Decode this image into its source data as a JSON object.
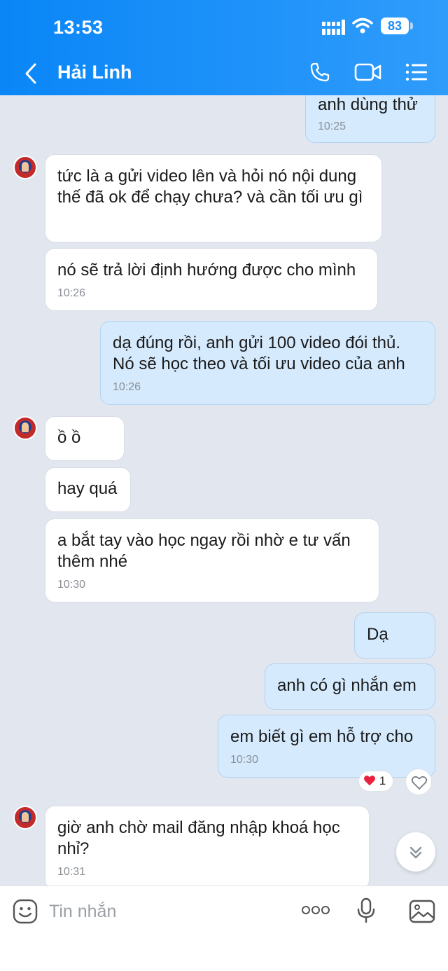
{
  "status_bar": {
    "time": "13:53",
    "battery": "83"
  },
  "header": {
    "contact_name": "Hải Linh"
  },
  "messages": [
    {
      "text": "anh dùng thử",
      "time": "10:25"
    },
    {
      "text": "tức là a gửi video lên và hỏi nó nội dung thế đã ok để chạy chưa? và cần tối ưu gì"
    },
    {
      "text": "nó sẽ trả lời định hướng được cho mình",
      "time": "10:26"
    },
    {
      "text": "dạ đúng rồi, anh gửi 100 video đói thủ. Nó sẽ học theo và tối ưu video của anh",
      "time": "10:26"
    },
    {
      "text": "ồ ồ"
    },
    {
      "text": "hay quá"
    },
    {
      "text": "a bắt tay vào học ngay rồi nhờ e tư vấn thêm nhé",
      "time": "10:30"
    },
    {
      "text": "Dạ"
    },
    {
      "text": "anh có gì nhắn em"
    },
    {
      "text": "em biết gì em hỗ trợ cho",
      "time": "10:30",
      "reaction_count": "1"
    },
    {
      "text": "giờ anh chờ mail đăng nhập khoá học nhỉ?",
      "time": "10:31"
    }
  ],
  "input": {
    "placeholder": "Tin nhắn"
  },
  "icons": [
    "back-icon",
    "phone-icon",
    "video-call-icon",
    "menu-icon",
    "emoji-icon",
    "more-icon",
    "microphone-icon",
    "image-icon",
    "heart-icon",
    "chevron-down-icon"
  ],
  "colors": {
    "header": "#0a86f7",
    "outgoing_bubble": "#d5eafd",
    "incoming_bubble": "#ffffff",
    "background": "#e2e7ef"
  }
}
